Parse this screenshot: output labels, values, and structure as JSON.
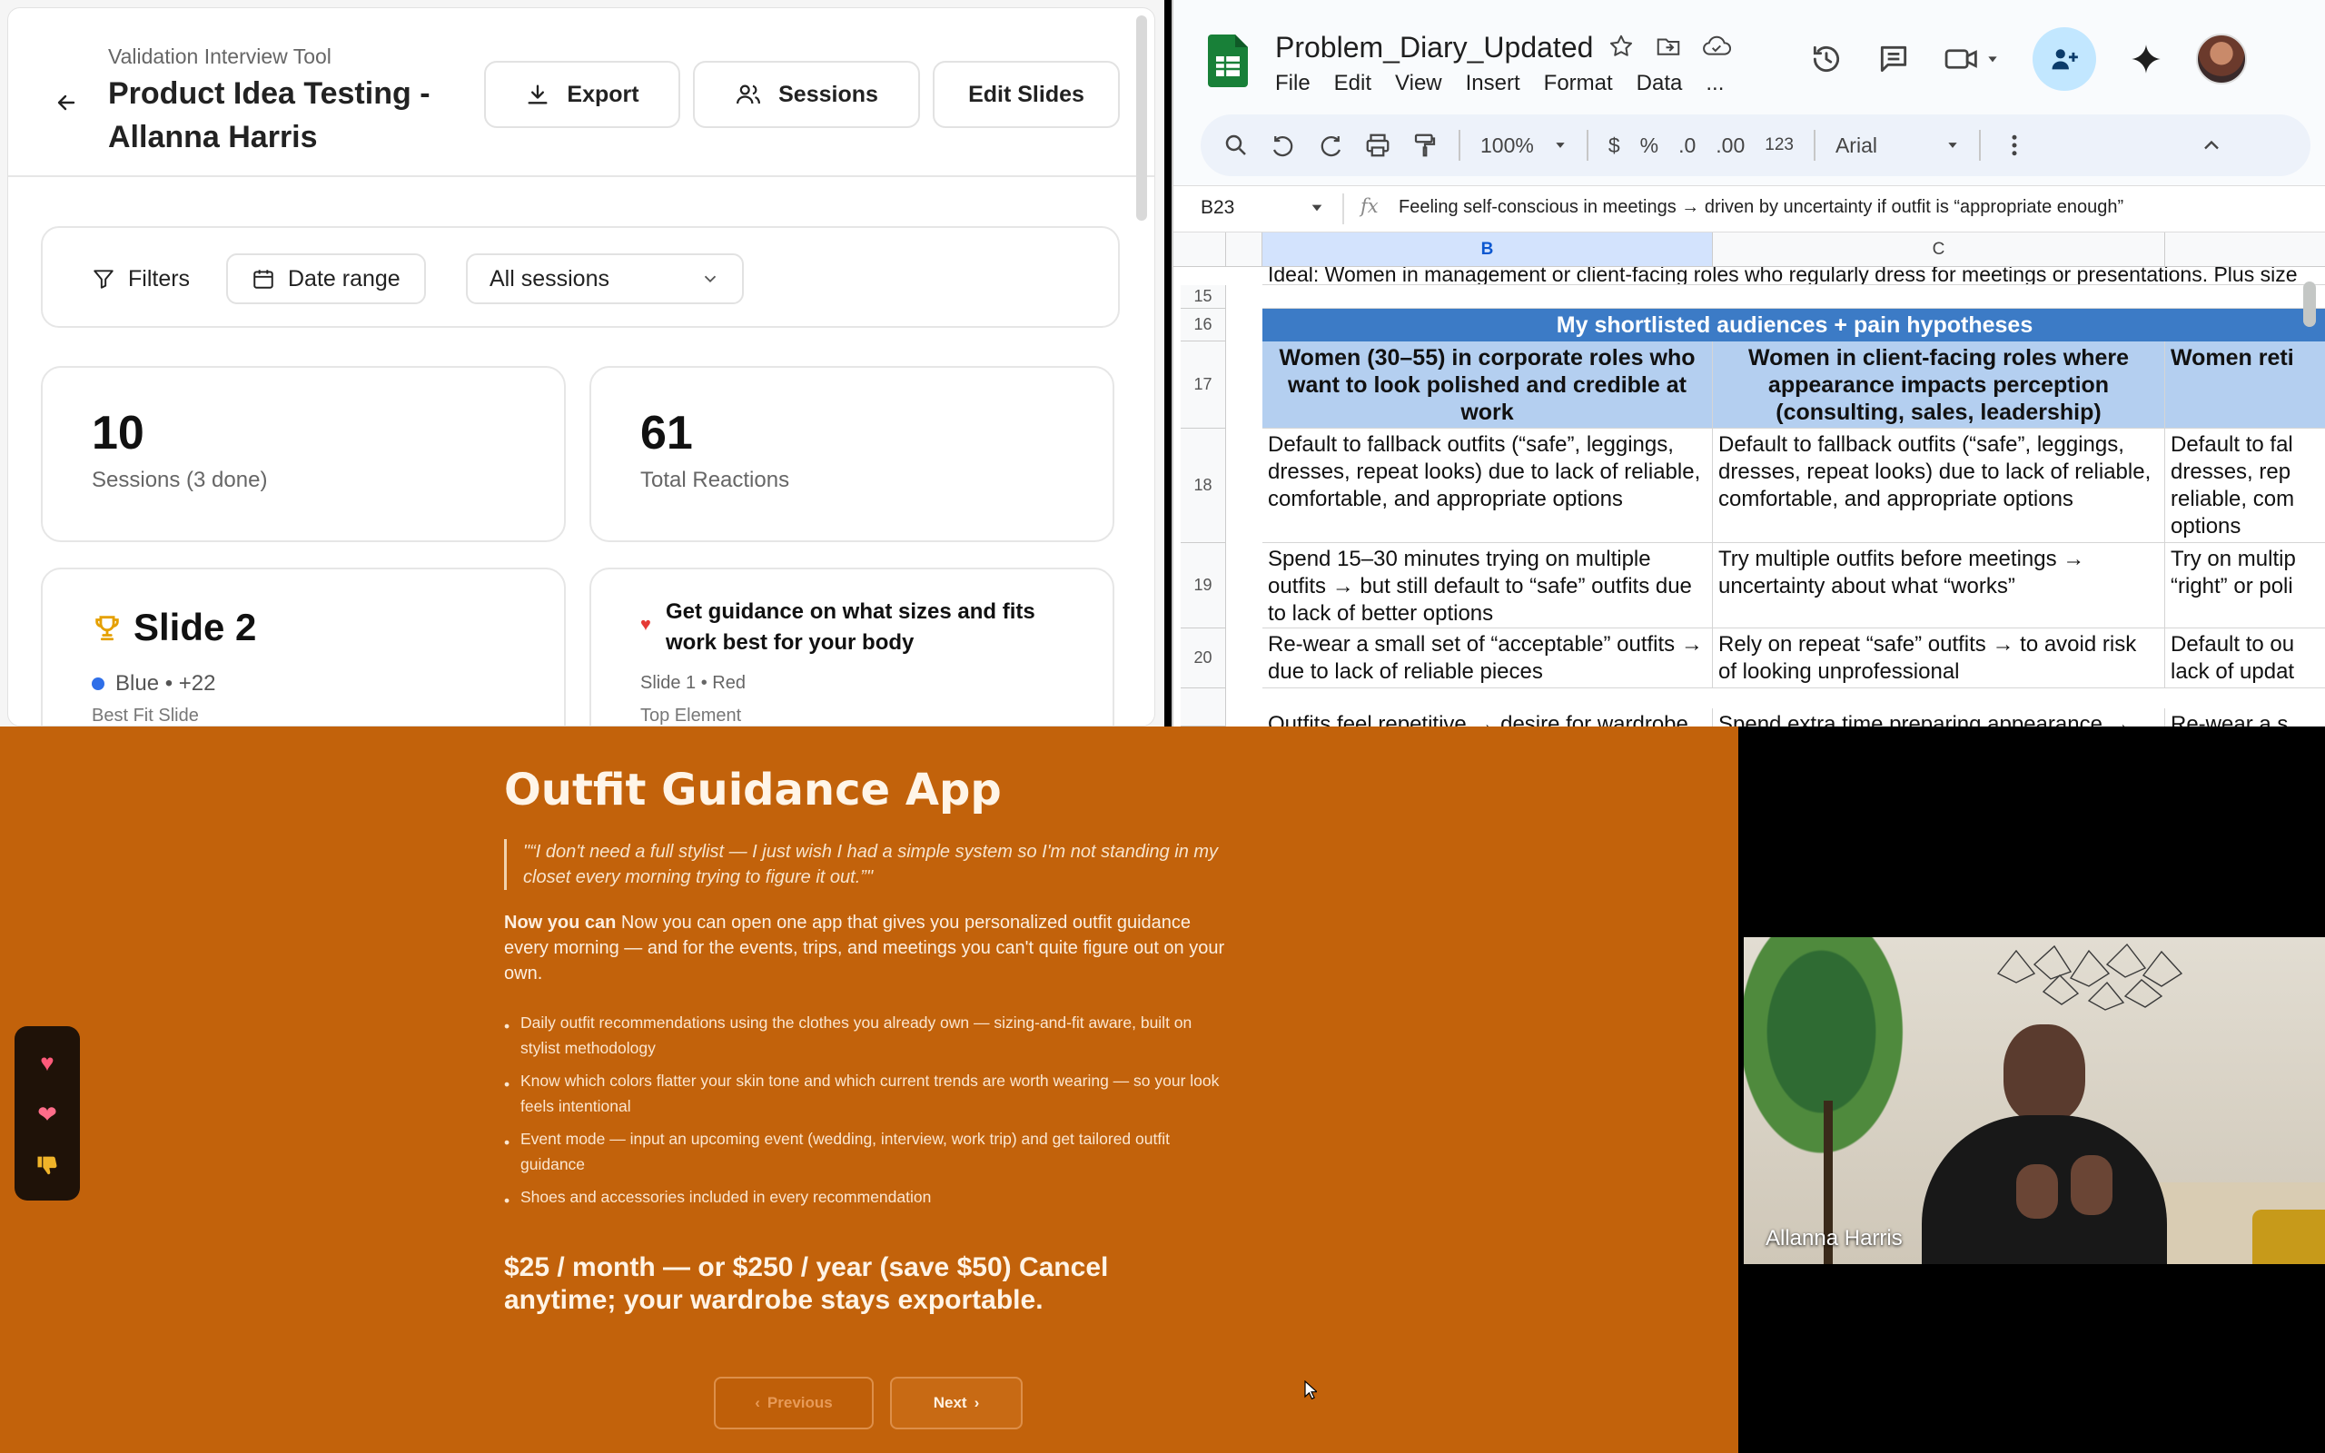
{
  "tool": {
    "kicker": "Validation Interview Tool",
    "title": "Product Idea Testing - Allanna Harris",
    "buttons": {
      "export": "Export",
      "sessions": "Sessions",
      "edit": "Edit Slides"
    },
    "filters": {
      "filters": "Filters",
      "date_range": "Date range",
      "sessions_select": "All sessions"
    },
    "stats": {
      "sessions_num": "10",
      "sessions_label": "Sessions (3 done)",
      "reactions_num": "61",
      "reactions_label": "Total Reactions"
    },
    "best_slide": {
      "title": "Slide 2",
      "meta": "Blue • +22",
      "label": "Best Fit Slide"
    },
    "top_element": {
      "text": "Get guidance on what sizes and fits work best for your body",
      "meta": "Slide 1 • Red",
      "label": "Top Element"
    }
  },
  "sheets": {
    "doc_title": "Problem_Diary_Updated",
    "menu": [
      "File",
      "Edit",
      "View",
      "Insert",
      "Format",
      "Data",
      "..."
    ],
    "toolbar": {
      "zoom": "100%",
      "currency": "$",
      "percent": "%",
      "dec_less": ".0",
      "dec_more": ".00",
      "number_format": "123",
      "font": "Arial"
    },
    "cell_ref": "B23",
    "formula": "Feeling self-conscious in meetings → driven by uncertainty if outfit is “appropriate enough”",
    "columns": [
      "B",
      "C"
    ],
    "rows": [
      "15",
      "16",
      "17",
      "18",
      "19",
      "20"
    ],
    "clipped_top": "Ideal: Women in management or client-facing roles who regularly dress for meetings or presentations. Plus size",
    "band": "My shortlisted audiences + pain hypotheses",
    "r17": [
      "Women (30–55) in corporate roles who want to look polished and credible at work",
      "Women in client-facing roles where appearance impacts perception (consulting, sales, leadership)",
      "Women reti"
    ],
    "r18": [
      "Default to fallback outfits (“safe”, leggings, dresses, repeat looks) due to lack of reliable, comfortable, and appropriate options",
      "Default to fallback outfits (“safe”, leggings, dresses, repeat looks) due to lack of reliable, comfortable, and appropriate options",
      "Default to fal dresses, rep reliable, com options"
    ],
    "r19": [
      "Spend 15–30 minutes trying on multiple outfits → but still default to “safe” outfits due to lack of better options",
      "Try multiple outfits before meetings → uncertainty about what “works”",
      "Try on multip “right” or poli"
    ],
    "r20": [
      "Re-wear a small set of “acceptable” outfits → due to lack of reliable pieces",
      "Rely on repeat “safe” outfits → to avoid risk of looking unprofessional",
      "Default to ou lack of updat"
    ],
    "r21": [
      "Outfits feel repetitive → desire for wardrobe",
      "Spend extra time preparing appearance →",
      "Re-wear a s"
    ]
  },
  "slide": {
    "title": "Outfit Guidance App",
    "quote": "\"“I don't need a full stylist — I just wish I had a simple system so I'm not standing in my closet every morning trying to figure it out.”\"",
    "lead_bold": "Now you can",
    "lead": " Now you can open one app that gives you personalized outfit guidance every morning — and for the events, trips, and meetings you can't quite figure out on your own.",
    "bullets": [
      "Daily outfit recommendations using the clothes you already own — sizing-and-fit aware, built on stylist methodology",
      "Know which colors flatter your skin tone and which current trends are worth wearing — so your look feels intentional",
      "Event mode — input an upcoming event (wedding, interview, work trip) and get tailored outfit guidance",
      "Shoes and accessories included in every recommendation"
    ],
    "price": "$25 / month — or $250 / year (save $50) Cancel anytime; your wardrobe stays exportable.",
    "prev": "Previous",
    "next": "Next",
    "reactions": [
      "heart",
      "sparkling-heart",
      "thumbs-down"
    ]
  },
  "video": {
    "participant": "Allanna Harris"
  },
  "colors": {
    "slide_bg": "#c2620b",
    "sheet_band": "#3c7bc6",
    "sheet_header": "#b4cff0",
    "share_btn": "#c2e7ff"
  }
}
